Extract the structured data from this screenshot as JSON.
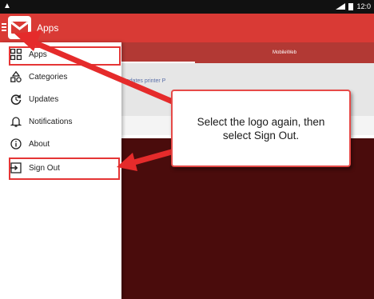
{
  "status_bar": {
    "warning_icon": "warning-icon",
    "time": "12:0"
  },
  "app_bar": {
    "title": "Apps",
    "logo_icon": "envelope-logo-icon",
    "menu_icon": "hamburger-icon"
  },
  "tabs": [
    {
      "label": ""
    },
    {
      "label": "MobileWeb"
    }
  ],
  "content": {
    "row_text": "updates printer P"
  },
  "drawer": {
    "items": [
      {
        "label": "Apps",
        "icon": "grid-icon"
      },
      {
        "label": "Categories",
        "icon": "shapes-icon"
      },
      {
        "label": "Updates",
        "icon": "refresh-icon"
      },
      {
        "label": "Notifications",
        "icon": "bell-icon"
      },
      {
        "label": "About",
        "icon": "info-icon"
      },
      {
        "label": "Sign Out",
        "icon": "sign-out-icon"
      }
    ]
  },
  "callout": {
    "text": "Select the logo again, then select Sign Out."
  },
  "colors": {
    "accent": "#d93a35",
    "highlight": "#e53535",
    "tab_bar": "#b23934",
    "dark_background": "#4a0c0c"
  }
}
